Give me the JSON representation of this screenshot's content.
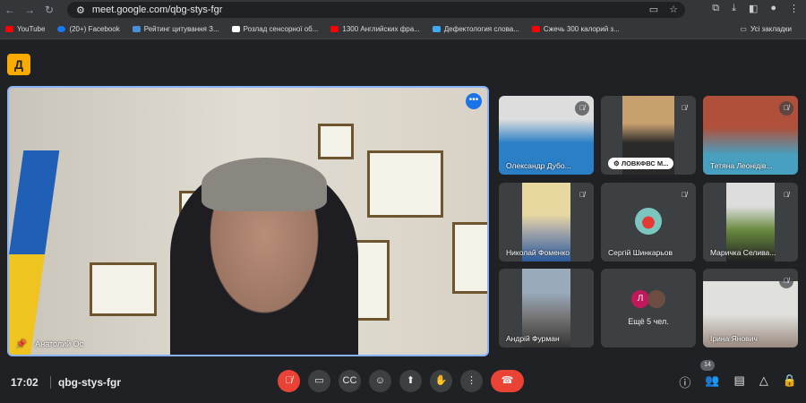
{
  "browser": {
    "url": "meet.google.com/qbg-stys-fgr",
    "bookmarks": [
      "YouTube",
      "(20+) Facebook",
      "Рейтинг цитування З...",
      "Розлад сенсорної об...",
      "1300 Английских фра...",
      "Дефектология слова...",
      "Сжечь 300 калорий з..."
    ],
    "bookmark_colors": [
      "#ff0000",
      "#1877f2",
      "#4a90d9",
      "#ffffff",
      "#ff0000",
      "#3fa9f5",
      "#ff0000"
    ],
    "all_bookmarks": "Усі закладки"
  },
  "app": {
    "logo": "Д"
  },
  "main_video": {
    "name": "Анатолий Ос"
  },
  "tiles": [
    {
      "name": "Олександр Дубо...",
      "muted": true
    },
    {
      "name": "ЛОВКФВС М...",
      "muted": true,
      "pill": true
    },
    {
      "name": "Тетяна Леонідів...",
      "muted": true
    },
    {
      "name": "Николай Фоменко",
      "muted": true
    },
    {
      "name": "Сергій Шинкарьов",
      "muted": true,
      "avatar": true
    },
    {
      "name": "Маричка Селива...",
      "muted": true
    },
    {
      "name": "Андрій Фурман",
      "muted": false
    },
    {
      "name": "Ещё 5 чел.",
      "initial": "Л"
    },
    {
      "name": "Ірина Янович",
      "muted": true
    }
  ],
  "bottom": {
    "time": "17:02",
    "meeting_code": "qbg-stys-fgr",
    "participants_count": "14"
  }
}
